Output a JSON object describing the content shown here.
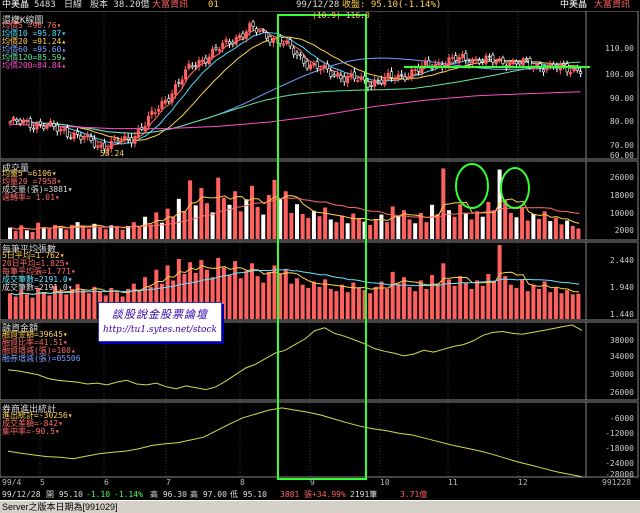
{
  "header": {
    "stock_name": "中美晶",
    "code": "5483",
    "period": "日線",
    "capital": "股本 38.20億",
    "vendor": "大富資訊",
    "left_marker": "01",
    "cursor_date": "99/12/28",
    "cursor_close": "收盤: 95.10(-1.14%)",
    "stock_name_right": "中美晶",
    "vendor_right": "大富資訊"
  },
  "panels": {
    "price": {
      "title": "還權K線圖",
      "legend": [
        {
          "text": "均價5 =96.76▾",
          "color": "#ff6a6a"
        },
        {
          "text": "均價10 =95.87▾",
          "color": "#4cd9ff"
        },
        {
          "text": "均價20 =91.24▴",
          "color": "#ffd24c"
        },
        {
          "text": "均價60 =95.60▴",
          "color": "#7aa0ff"
        },
        {
          "text": "均價120=85.59▴",
          "color": "#66e3a0"
        },
        {
          "text": "均價200=84.84▴",
          "color": "#ff4cc8"
        }
      ],
      "ticks": [
        "110.00",
        "100.00",
        "90.00",
        "80.00",
        "70.00",
        "60.00"
      ],
      "peak_label": "(10.9) 116.0",
      "low_label": "58.24"
    },
    "volume": {
      "title": "成交量",
      "legend": [
        {
          "text": "均量5 =6106▾",
          "color": "#ffd24c"
        },
        {
          "text": "均量20 =7958▾",
          "color": "#ff6a6a"
        },
        {
          "text": "成交量(張)=3881▾",
          "color": "#ddd"
        },
        {
          "text": "週轉率= 1.01▾",
          "color": "#ff6a6a"
        }
      ],
      "ticks": [
        "26000",
        "18000",
        "10000",
        "2000"
      ]
    },
    "avg_per_trade": {
      "title": "每筆平均張數",
      "legend": [
        {
          "text": "5日平均=1.762▾",
          "color": "#ffd24c"
        },
        {
          "text": "20日平均=1.825▾",
          "color": "#ff6a6a"
        },
        {
          "text": "每筆平均張=1.771▾",
          "color": "#ff6a6a"
        },
        {
          "text": "成交筆數=2191.0▾",
          "color": "#66e3ff"
        },
        {
          "text": "成交筆數=2191.0▾",
          "color": "#ddd"
        }
      ],
      "ticks": [
        "2.440",
        "1.940",
        "1.440"
      ]
    },
    "margin": {
      "title": "融資金額",
      "legend": [
        {
          "text": "融資金額=39645▾",
          "color": "#ffd24c"
        },
        {
          "text": "融資比率=41.51▾",
          "color": "#ff6a6a"
        },
        {
          "text": "融資增減(張)=100▴",
          "color": "#ff6a6a"
        },
        {
          "text": "融券增減(張)=05506",
          "color": "#7aa0ff"
        }
      ],
      "ticks": [
        "38000",
        "34000",
        "30000",
        "26000"
      ]
    },
    "broker": {
      "title": "券商進出統計",
      "legend": [
        {
          "text": "進出統計=-30256▾",
          "color": "#ffd24c"
        },
        {
          "text": "成交差額=-842▾",
          "color": "#ff6a6a"
        },
        {
          "text": "集中率=-90.5▾",
          "color": "#ff6a6a"
        }
      ],
      "ticks": [
        "-6000",
        "-12000",
        "-18000",
        "-24000",
        "-28000"
      ]
    }
  },
  "date_axis": {
    "labels": [
      "99/4",
      "5",
      "6",
      "7",
      "8",
      "9",
      "10",
      "11",
      "12"
    ],
    "end_label": "991228"
  },
  "status_row": {
    "date": "99/12/28",
    "open": "開 95.10",
    "change": "-1.10",
    "pct": "-1.14%",
    "high": "高 96.30",
    "low": "高 97.00",
    "close": "低 95.10",
    "volume": "3881 張+34.99%",
    "trades": "2191筆",
    "amount": "3.71億"
  },
  "watermark": {
    "title": "談股說金股票論壇",
    "url": "http://tu1.sytes.net/stock"
  },
  "status_bar": {
    "text": "Server之版本日期為[991029]"
  },
  "annotations": {
    "highlight_color": "#33ff33",
    "up_color": "#ff6060",
    "down_color": "#ffffff"
  },
  "chart_data": [
    {
      "type": "candlestick",
      "title": "還權K線圖",
      "ylim": [
        55,
        120
      ],
      "x": [
        "99/4",
        "5",
        "6",
        "7",
        "8",
        "9",
        "10",
        "11",
        "12"
      ],
      "close_trend": [
        71,
        70,
        66,
        60,
        63,
        78,
        96,
        105,
        114,
        108,
        97,
        92,
        89,
        92,
        97,
        100,
        99,
        98,
        96,
        95.1
      ],
      "ma200_trend": [
        70,
        69,
        68,
        68,
        69,
        71,
        74,
        78,
        81,
        83,
        84,
        84.84
      ]
    },
    {
      "type": "bar",
      "title": "成交量",
      "ylim": [
        0,
        28000
      ],
      "values": [
        4200,
        3000,
        5000,
        3200,
        2600,
        6000,
        4300,
        3800,
        5200,
        4100,
        3500,
        5200,
        6200,
        4800,
        3800,
        5600,
        4200,
        3600,
        5000,
        4400,
        3400,
        4800,
        6200,
        4400,
        8200,
        5400,
        9800,
        6000,
        11200,
        8200,
        14800,
        10200,
        21600,
        12400,
        18800,
        13200,
        9800,
        22600,
        15200,
        12600,
        17600,
        10200,
        14600,
        19600,
        11800,
        9000,
        16200,
        21800,
        14800,
        17600,
        9600,
        12800,
        9200,
        7800,
        10400,
        8400,
        11600,
        7200,
        6200,
        8600,
        5800,
        9400,
        7600,
        6400,
        5200,
        7400,
        9000,
        6200,
        12000,
        8400,
        10600,
        7200,
        5800,
        9600,
        6200,
        12600,
        9200,
        26000,
        10600,
        8200,
        12800,
        9600,
        7200,
        10200,
        8200,
        13600,
        10600,
        25600,
        14200,
        9600,
        8000,
        11800,
        6800,
        9200,
        7400,
        10200,
        6600,
        7800,
        5400,
        6800,
        4800,
        3881
      ]
    },
    {
      "type": "bar",
      "title": "每筆平均張數",
      "ylim": [
        1.3,
        2.7
      ],
      "values": [
        1.78,
        1.72,
        1.84,
        1.76,
        1.7,
        1.88,
        1.8,
        1.74,
        1.92,
        1.82,
        1.76,
        1.86,
        1.95,
        1.84,
        1.78,
        1.9,
        1.82,
        1.74,
        1.88,
        1.8,
        1.72,
        1.86,
        1.96,
        1.84,
        2.08,
        1.9,
        2.22,
        1.96,
        2.3,
        2.02,
        2.42,
        2.14,
        2.36,
        2.16,
        2.4,
        2.22,
        2.08,
        2.44,
        2.26,
        2.12,
        2.38,
        2.06,
        2.2,
        2.34,
        2.1,
        1.98,
        2.18,
        2.3,
        2.14,
        2.22,
        1.96,
        2.06,
        1.94,
        1.88,
        2.0,
        1.9,
        2.04,
        1.86,
        1.82,
        1.94,
        1.8,
        1.98,
        1.88,
        1.84,
        1.78,
        1.9,
        2.0,
        1.86,
        2.18,
        1.96,
        2.08,
        1.9,
        1.82,
        2.02,
        1.86,
        2.12,
        1.96,
        2.34,
        2.04,
        1.92,
        2.1,
        1.98,
        1.86,
        2.02,
        1.92,
        2.14,
        2.0,
        2.68,
        2.1,
        1.94,
        1.88,
        2.04,
        1.82,
        1.94,
        1.86,
        2.0,
        1.8,
        1.88,
        1.78,
        1.84,
        1.76,
        1.771
      ]
    },
    {
      "type": "line",
      "title": "融資金額",
      "ylim": [
        25000,
        41000
      ],
      "values": [
        31200,
        31000,
        30600,
        30200,
        29400,
        29000,
        28800,
        28600,
        28200,
        28400,
        28000,
        28600,
        29000,
        28200,
        28000,
        28400,
        27600,
        27200,
        27800,
        27400,
        27000,
        27600,
        28800,
        30200,
        31600,
        32400,
        33600,
        34800,
        35400,
        36600,
        37800,
        39600,
        40200,
        39000,
        38400,
        37600,
        36800,
        35800,
        35200,
        34800,
        34200,
        34600,
        35400,
        35000,
        35600,
        36200,
        36600,
        37400,
        38600,
        39200,
        39400,
        39000,
        38800,
        39200,
        39600,
        40000,
        40400,
        40800,
        39645
      ]
    },
    {
      "type": "line",
      "title": "券商進出統計",
      "ylim": [
        -30000,
        -4000
      ],
      "values": [
        -21000,
        -21800,
        -22400,
        -23000,
        -23200,
        -23800,
        -22800,
        -22000,
        -21400,
        -21000,
        -20200,
        -19000,
        -18400,
        -18000,
        -17000,
        -16000,
        -13600,
        -11200,
        -9000,
        -7600,
        -6200,
        -5400,
        -6200,
        -7000,
        -8000,
        -9400,
        -10800,
        -12000,
        -13000,
        -13600,
        -14600,
        -15200,
        -16400,
        -17600,
        -18800,
        -19800,
        -20800,
        -22000,
        -23400,
        -24800,
        -26000,
        -27200,
        -28400,
        -29400,
        -30256
      ]
    }
  ]
}
